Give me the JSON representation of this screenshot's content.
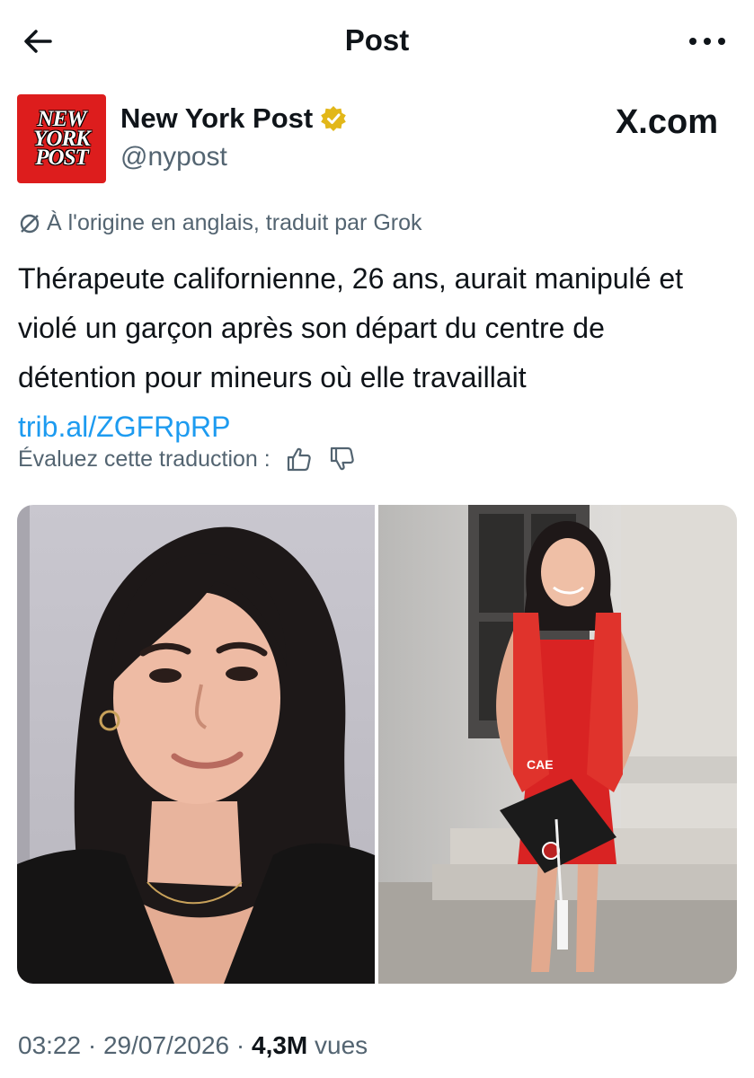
{
  "header": {
    "title": "Post",
    "back_icon": "arrow-left-icon",
    "more_icon": "ellipsis-icon"
  },
  "author": {
    "logo_lines": [
      "NEW",
      "YORK",
      "POST"
    ],
    "name": "New York Post",
    "handle": "@nypost",
    "verified_color": "#e2b719",
    "source_label": "X.com"
  },
  "translation": {
    "note": "À l'origine en anglais, traduit par Grok"
  },
  "tweet": {
    "text": "Thérapeute californienne, 26 ans, aurait manipulé et violé un garçon après son départ du centre de détention pour mineurs où elle travaillait",
    "link": "trib.al/ZGFRpRP",
    "link_color": "#1d9bf0"
  },
  "rating": {
    "label": "Évaluez cette traduction :"
  },
  "media": {
    "photo_right": {
      "stole_text": "CAE"
    }
  },
  "meta": {
    "time": "03:22",
    "separator": "·",
    "date": "29/07/2026",
    "views": "4,3M",
    "views_label": "vues"
  }
}
